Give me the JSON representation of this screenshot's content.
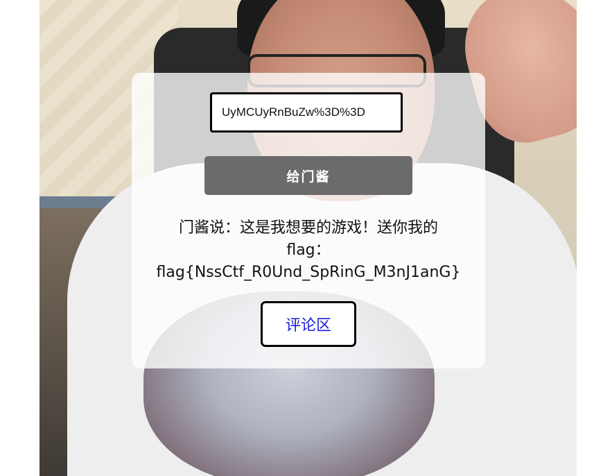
{
  "background": {
    "icon": "person-photo-background"
  },
  "form": {
    "input_value": "UyMCUyRnBuZw%3D%3D",
    "submit_label": "给门酱"
  },
  "result": {
    "line1": "门酱说：这是我想要的游戏！送你我的",
    "line2": "flag：",
    "line3": "flag{NssCtf_R0Und_SpRinG_M3nJ1anG}"
  },
  "links": {
    "comments_label": "评论区"
  },
  "colors": {
    "button_bg": "#6b6b6b",
    "link": "#1a1adb",
    "panel_bg": "rgba(255,255,255,0.78)"
  }
}
